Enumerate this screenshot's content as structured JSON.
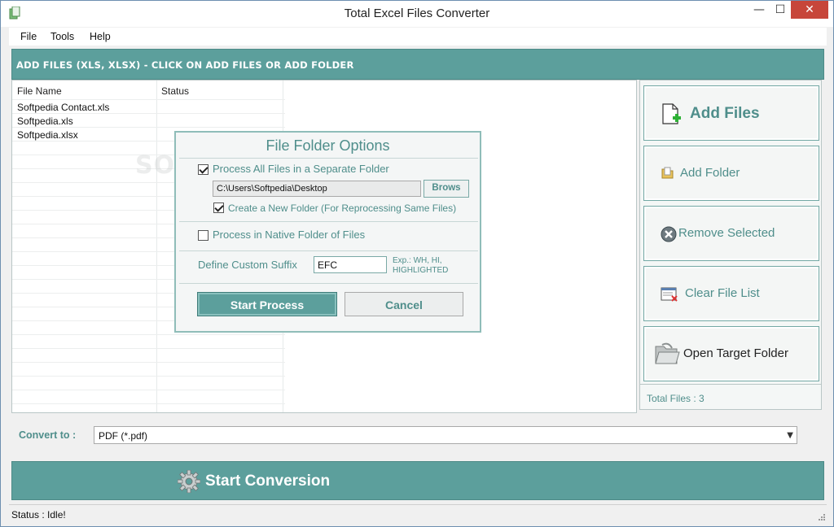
{
  "window": {
    "title": "Total Excel Files Converter",
    "minimize": "—",
    "maximize": "☐",
    "close": "✕"
  },
  "menu": {
    "items": [
      "File",
      "Tools",
      "Help"
    ]
  },
  "header": {
    "text": "ADD FILES (XLS, XLSX) - CLICK ON ADD FILES OR ADD FOLDER"
  },
  "file_list": {
    "columns": [
      "File Name",
      "Status"
    ],
    "rows": [
      {
        "name": "Softpedia Contact.xls",
        "status": ""
      },
      {
        "name": "Softpedia.xls",
        "status": ""
      },
      {
        "name": "Softpedia.xlsx",
        "status": ""
      }
    ]
  },
  "side_panel": {
    "buttons": [
      {
        "label": "Add Files",
        "icon": "add-file-icon"
      },
      {
        "label": "Add Folder",
        "icon": "folder-icon"
      },
      {
        "label": "Remove Selected",
        "icon": "remove-icon"
      },
      {
        "label": "Clear File List",
        "icon": "clear-list-icon"
      },
      {
        "label": "Open Target Folder",
        "icon": "open-folder-icon"
      }
    ],
    "total_files": "Total Files : 3"
  },
  "convert": {
    "label": "Convert to :",
    "selected": "PDF (*.pdf)"
  },
  "start_conversion": {
    "label": "Start Conversion",
    "icon": "gear-icon"
  },
  "status": {
    "text": "Status  :  Idle!"
  },
  "watermark": {
    "text": "SOFTPEDIA"
  },
  "dialog": {
    "title": "File Folder Options",
    "separate_folder_label": "Process All Files in a Separate Folder",
    "separate_folder_checked": true,
    "path_value": "C:\\Users\\Softpedia\\Desktop",
    "browse_label": "Brows",
    "create_new_label": "Create a New Folder (For Reprocessing Same Files)",
    "create_new_checked": true,
    "native_folder_label": "Process in Native Folder of Files",
    "native_folder_checked": false,
    "suffix_label": "Define Custom Suffix",
    "suffix_value": "EFC",
    "suffix_example": "Exp.: WH, HI, HIGHLIGHTED",
    "start_label": "Start Process",
    "cancel_label": "Cancel"
  },
  "colors": {
    "accent": "#5c9f9c",
    "accent_text": "#4f8e8b",
    "close_red": "#c7463a"
  }
}
